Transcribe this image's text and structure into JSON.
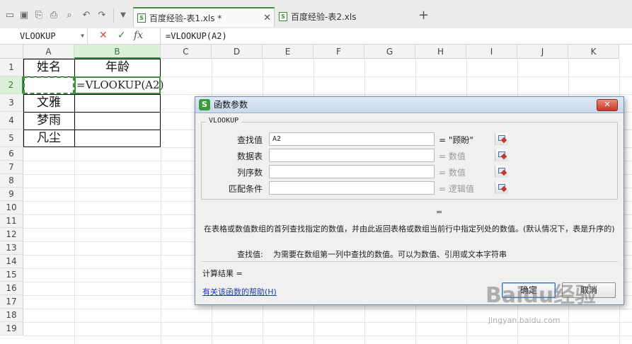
{
  "tabs": [
    {
      "label": "百度经验-表1.xls *",
      "active": true,
      "icon": "sheet-file-icon"
    },
    {
      "label": "百度经验-表2.xls",
      "active": false,
      "icon": "sheet-file-icon"
    }
  ],
  "formula_bar": {
    "name_box": "VLOOKUP",
    "cancel": "✕",
    "confirm": "✓",
    "fx": "fx",
    "content": "=VLOOKUP(A2)"
  },
  "columns": [
    "A",
    "B",
    "C",
    "D",
    "E",
    "F",
    "G",
    "H",
    "I",
    "J",
    "K"
  ],
  "rows": [
    "1",
    "2",
    "3",
    "4",
    "5",
    "6",
    "7",
    "8",
    "9",
    "10",
    "11",
    "12",
    "13",
    "14",
    "15",
    "16",
    "17",
    "18",
    "19"
  ],
  "cells": {
    "A1": "姓名",
    "B1": "年龄",
    "A3": "文雅",
    "A4": "梦雨",
    "A5": "凡尘",
    "B2_edit": "=VLOOKUP(A2)"
  },
  "dialog": {
    "title": "函数参数",
    "function_name": "VLOOKUP",
    "args": [
      {
        "label": "查找值",
        "value": "A2",
        "result": "= \"顾盼\"",
        "grey": false
      },
      {
        "label": "数据表",
        "value": "",
        "result": "= 数值",
        "grey": true
      },
      {
        "label": "列序数",
        "value": "",
        "result": "= 数值",
        "grey": true
      },
      {
        "label": "匹配条件",
        "value": "",
        "result": "= 逻辑值",
        "grey": true
      }
    ],
    "center_eq": "=",
    "description": "在表格或数值数组的首列查找指定的数值，并由此返回表格或数组当前行中指定列处的数值。(默认情况下，表是升序的)",
    "param_label": "查找值:",
    "param_desc": "为需要在数组第一列中查找的数值。可以为数值、引用或文本字符串",
    "result_label": "计算结果  =",
    "help_link": "有关该函数的帮助(H)",
    "ok": "确定",
    "cancel": "取消",
    "close": "✕"
  },
  "watermark": {
    "main": "Baidu经验",
    "sub": "jingyan.baidu.com"
  },
  "colors": {
    "accent_green": "#3d8f41",
    "dialog_border": "#7a8fa6",
    "close_red": "#c6392a"
  }
}
